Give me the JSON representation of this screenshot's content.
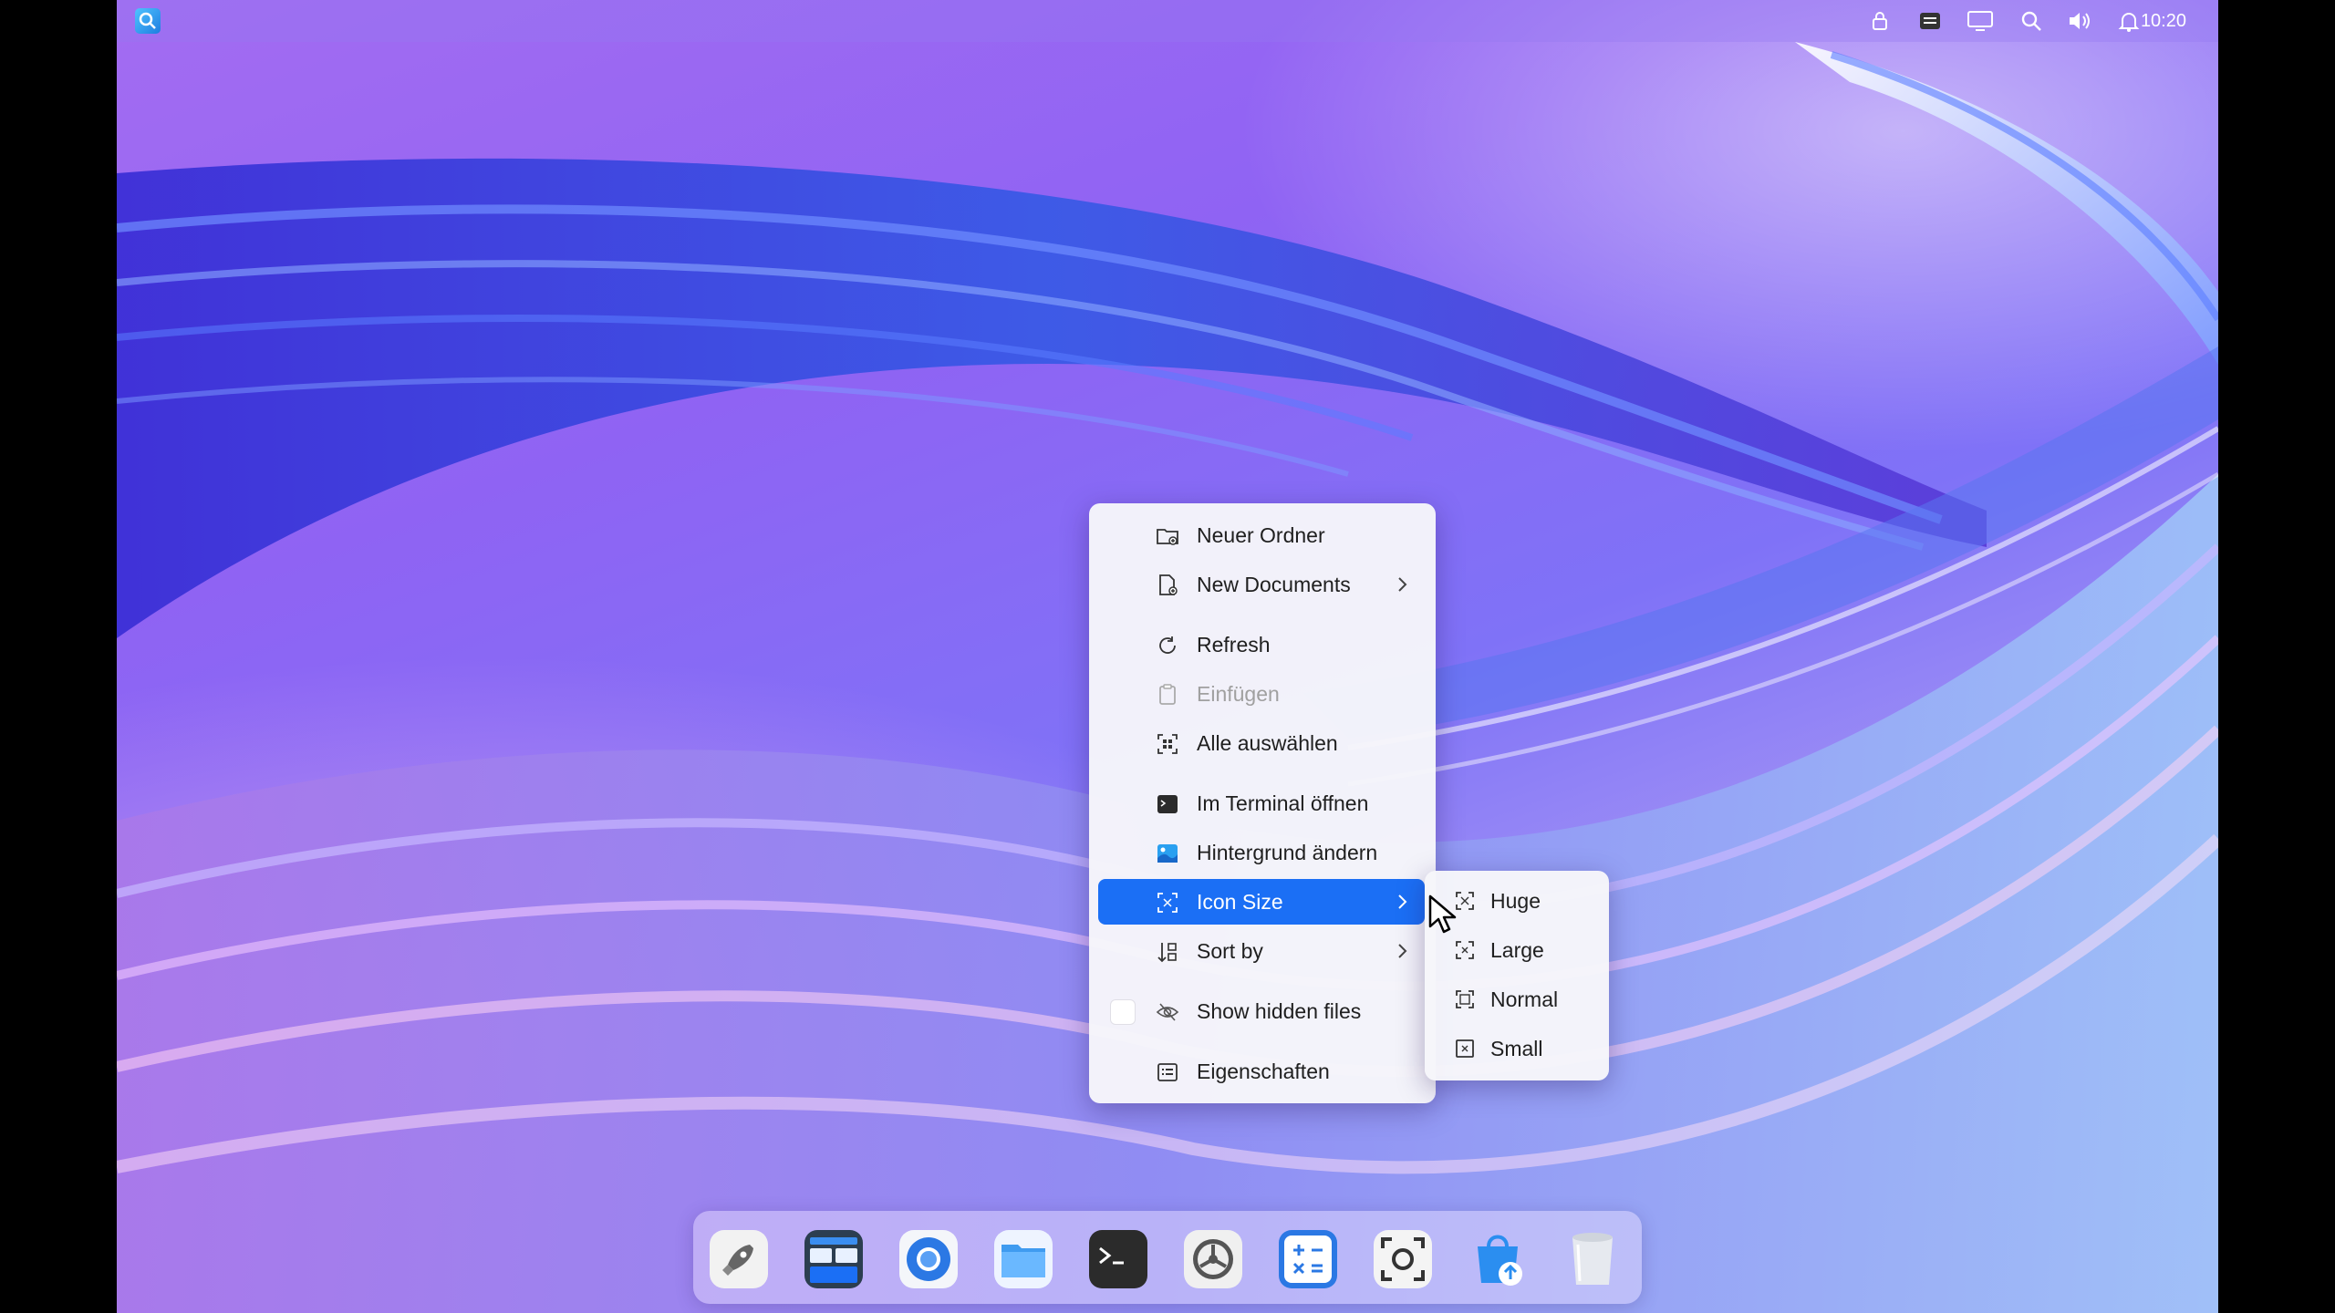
{
  "top_panel": {
    "clock": "10:20",
    "icons": [
      "launcher-icon",
      "lock-icon",
      "keyboard-icon",
      "display-icon",
      "search-icon",
      "volume-icon",
      "notification-icon"
    ]
  },
  "context_menu": {
    "items": [
      {
        "label": "Neuer Ordner",
        "icon": "new-folder-icon"
      },
      {
        "label": "New Documents",
        "icon": "new-document-icon",
        "submenu": true
      },
      {
        "label": "Refresh",
        "icon": "refresh-icon"
      },
      {
        "label": "Einfügen",
        "icon": "paste-icon",
        "disabled": true
      },
      {
        "label": "Alle auswählen",
        "icon": "select-all-icon"
      },
      {
        "label": "Im Terminal öffnen",
        "icon": "terminal-icon"
      },
      {
        "label": "Hintergrund ändern",
        "icon": "wallpaper-icon"
      },
      {
        "label": "Icon Size",
        "icon": "icon-size-icon",
        "submenu": true,
        "active": true
      },
      {
        "label": "Sort by",
        "icon": "sort-icon",
        "submenu": true
      },
      {
        "label": "Show hidden files",
        "icon": "hidden-files-icon",
        "checkbox": false
      },
      {
        "label": "Eigenschaften",
        "icon": "properties-icon"
      }
    ]
  },
  "icon_size_submenu": {
    "items": [
      {
        "label": "Huge",
        "icon": "huge-size-icon"
      },
      {
        "label": "Large",
        "icon": "large-size-icon"
      },
      {
        "label": "Normal",
        "icon": "normal-size-icon"
      },
      {
        "label": "Small",
        "icon": "small-size-icon"
      }
    ]
  },
  "dock": {
    "apps": [
      "launcher",
      "multitasking-view",
      "browser",
      "file-manager",
      "terminal",
      "control-center",
      "calculator",
      "screenshot",
      "app-store",
      "trash"
    ]
  },
  "colors": {
    "accent": "#1b6ff5",
    "menu_bg": "#f6f6fa"
  }
}
